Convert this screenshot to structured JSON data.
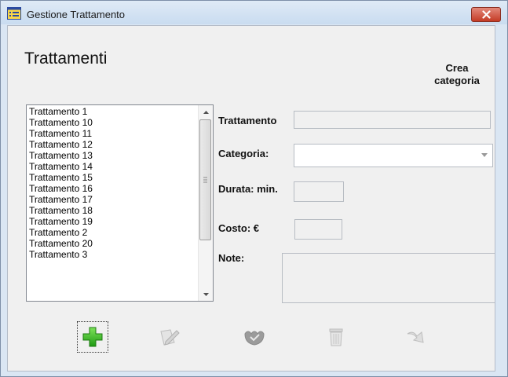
{
  "window": {
    "title": "Gestione Trattamento",
    "icon": "app-list-icon",
    "close_icon": "close-icon"
  },
  "header": {
    "title": "Trattamenti",
    "crea_line1": "Crea",
    "crea_line2": "categoria"
  },
  "list": {
    "items": [
      "Trattamento 1",
      "Trattamento 10",
      "Trattamento 11",
      "Trattamento 12",
      "Trattamento 13",
      "Trattamento 14",
      "Trattamento 15",
      "Trattamento 16",
      "Trattamento 17",
      "Trattamento 18",
      "Trattamento 19",
      "Trattamento 2",
      "Trattamento 20",
      "Trattamento 3"
    ]
  },
  "form": {
    "trattamento_label": "Trattamento",
    "trattamento_value": "",
    "categoria_label": "Categoria:",
    "categoria_value": "",
    "durata_label": "Durata: min.",
    "durata_value": "",
    "costo_label": "Costo: €",
    "costo_value": "",
    "note_label": "Note:",
    "note_value": ""
  },
  "toolbar": {
    "add_icon": "add-plus-icon",
    "edit_icon": "edit-icon",
    "save_icon": "save-icon",
    "delete_icon": "trash-icon",
    "undo_icon": "undo-arrow-icon",
    "accent": "#37b81d"
  }
}
